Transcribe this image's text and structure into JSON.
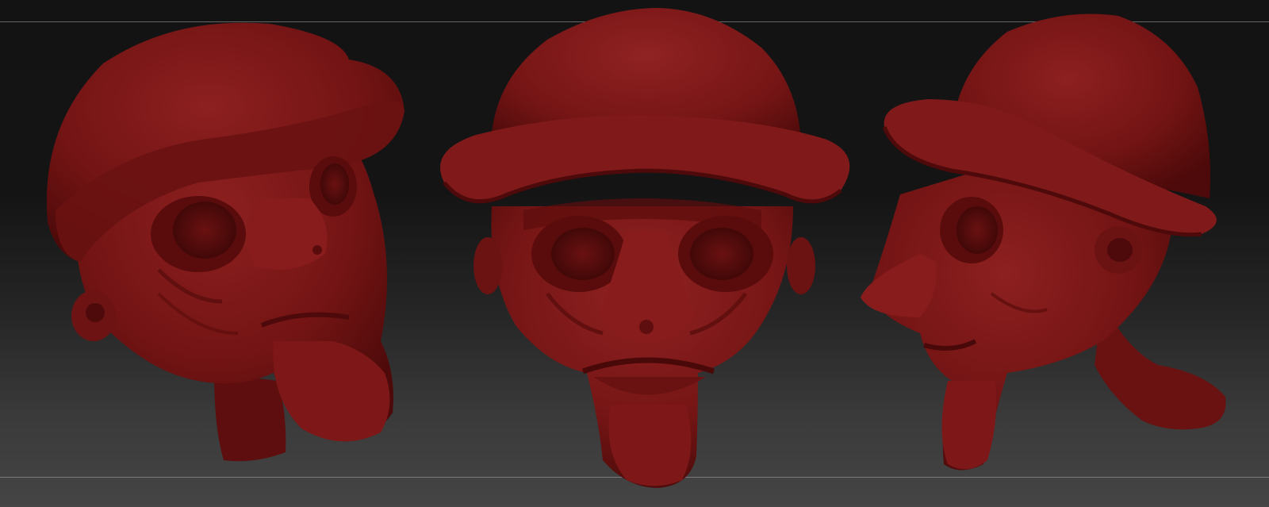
{
  "viewer": {
    "title": "",
    "colors": {
      "clay": "#7a1616",
      "clay_shadow": "#4b0909",
      "clay_highlight": "#9a2a2a",
      "background_top": "#131313",
      "background_bottom": "#454545"
    },
    "views": [
      {
        "name": "three-quarter-left"
      },
      {
        "name": "front"
      },
      {
        "name": "profile-left"
      }
    ]
  }
}
